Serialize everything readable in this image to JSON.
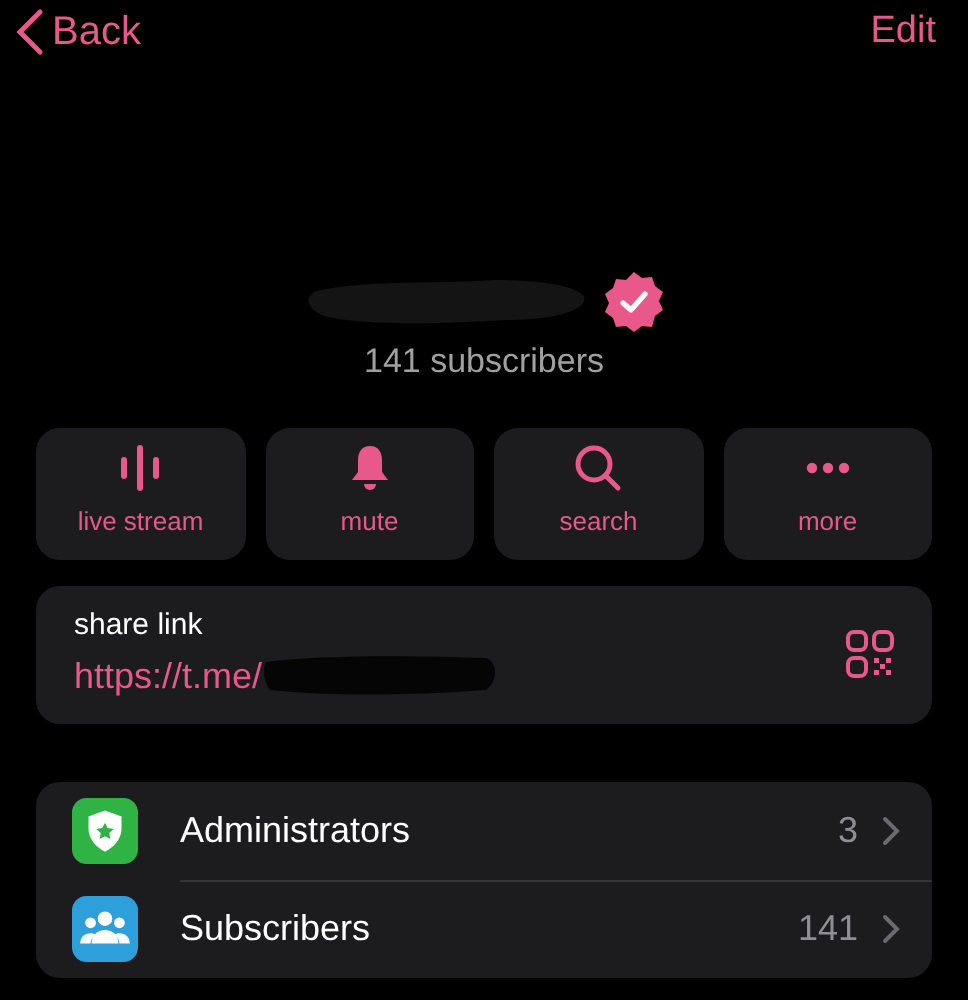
{
  "nav": {
    "back": "Back",
    "edit": "Edit"
  },
  "channel": {
    "verified": true,
    "subscribers": "141 subscribers"
  },
  "actions": [
    {
      "kind": "live",
      "label": "live stream"
    },
    {
      "kind": "mute",
      "label": "mute"
    },
    {
      "kind": "search",
      "label": "search"
    },
    {
      "kind": "more",
      "label": "more"
    }
  ],
  "share": {
    "label": "share link",
    "link": "https://t.me/"
  },
  "rows": [
    {
      "kind": "admins",
      "color": "#2fb344",
      "label": "Administrators",
      "count": "3"
    },
    {
      "kind": "members",
      "color": "#2d9fdb",
      "label": "Subscribers",
      "count": "141"
    }
  ]
}
